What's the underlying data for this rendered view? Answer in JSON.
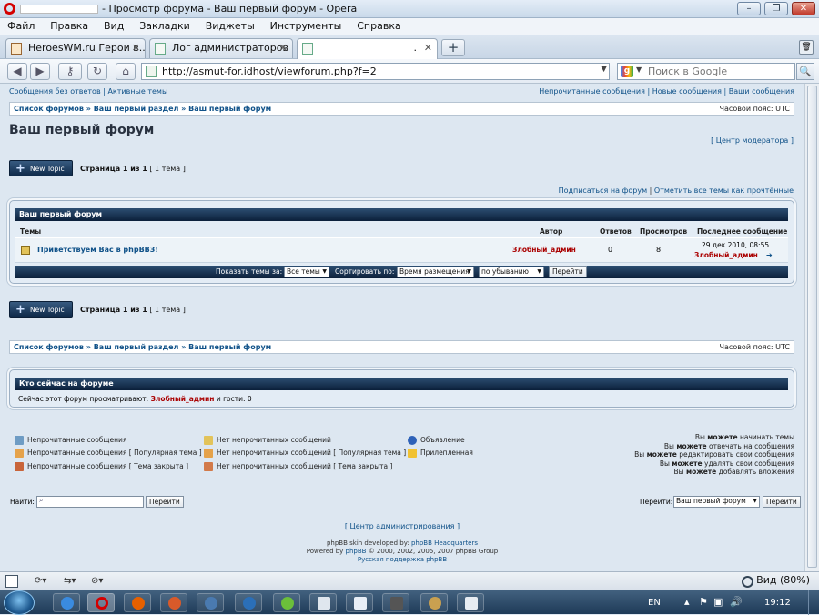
{
  "window": {
    "title": "- Просмотр форума - Ваш первый форум - Opera"
  },
  "menu": [
    "Файл",
    "Правка",
    "Вид",
    "Закладки",
    "Виджеты",
    "Инструменты",
    "Справка"
  ],
  "tabs": [
    {
      "label": "HeroesWM.ru Герои в..."
    },
    {
      "label": "Лог администраторов"
    },
    {
      "label": "."
    }
  ],
  "address": {
    "url": "http://asmut-for.idhost/viewforum.php?f=2",
    "search_placeholder": "Поиск в Google"
  },
  "top_links": {
    "left": "Сообщения без ответов | Активные темы",
    "right": "Непрочитанные сообщения | Новые сообщения | Ваши сообщения"
  },
  "breadcrumb": {
    "items": [
      "Список форумов",
      "»",
      "Ваш первый раздел",
      "»",
      "Ваш первый форум"
    ],
    "timezone": "Часовой пояс: UTC"
  },
  "forum": {
    "title": "Ваш первый форум",
    "moderator_link": "[ Центр модератора ]",
    "new_topic": "New Topic",
    "pagination_bold": "Страница 1 из 1",
    "pagination_count": "[ 1 тема ]",
    "subscribe": "Подписаться на форум",
    "mark_read": "Отметить все темы как прочтённые",
    "sep": "|"
  },
  "topics_box": {
    "header": "Ваш первый форум",
    "columns": {
      "topics": "Темы",
      "author": "Автор",
      "replies": "Ответов",
      "views": "Просмотров",
      "last": "Последнее сообщение"
    },
    "rows": [
      {
        "title": "Приветствуем Вас в phpBB3!",
        "author": "Злобный_админ",
        "replies": "0",
        "views": "8",
        "last_date": "29 дек 2010, 08:55",
        "last_author": "Злобный_админ"
      }
    ],
    "sort": {
      "show_label": "Показать темы за:",
      "show_value": "Все темы",
      "sort_label": "Сортировать по:",
      "sort_value": "Время размещения",
      "order_value": "по убыванию",
      "go": "Перейти"
    }
  },
  "who_online": {
    "header": "Кто сейчас на форуме",
    "text_before": "Сейчас этот форум просматривают:",
    "user": "Злобный_админ",
    "text_after": "и гости: 0"
  },
  "legend": {
    "col1": [
      "Непрочитанные сообщения",
      "Непрочитанные сообщения [ Популярная тема ]",
      "Непрочитанные сообщения [ Тема закрыта ]"
    ],
    "col2": [
      "Нет непрочитанных сообщений",
      "Нет непрочитанных сообщений [ Популярная тема ]",
      "Нет непрочитанных сообщений [ Тема закрыта ]"
    ],
    "col3": [
      "Объявление",
      "Прилепленная"
    ]
  },
  "permissions": [
    {
      "pre": "Вы ",
      "bold": "можете",
      "post": " начинать темы"
    },
    {
      "pre": "Вы ",
      "bold": "можете",
      "post": " отвечать на сообщения"
    },
    {
      "pre": "Вы ",
      "bold": "можете",
      "post": " редактировать свои сообщения"
    },
    {
      "pre": "Вы ",
      "bold": "можете",
      "post": " удалять свои сообщения"
    },
    {
      "pre": "Вы ",
      "bold": "можете",
      "post": " добавлять вложения"
    }
  ],
  "search": {
    "label": "Найти:",
    "go": "Перейти"
  },
  "jump": {
    "label": "Перейти:",
    "value": "Ваш первый форум",
    "go": "Перейти"
  },
  "footer": {
    "admin": "[ Центр администрирования ]",
    "line1_pre": "phpBB skin developed by: ",
    "line1_link": "phpBB Headquarters",
    "line2_pre": "Powered by ",
    "line2_link": "phpBB",
    "line2_post": " © 2000, 2002, 2005, 2007 phpBB Group",
    "line3": "Русская поддержка phpBB"
  },
  "statusbar": {
    "zoom": "Вид (80%)"
  },
  "taskbar": {
    "lang": "EN",
    "time": "19:12"
  }
}
